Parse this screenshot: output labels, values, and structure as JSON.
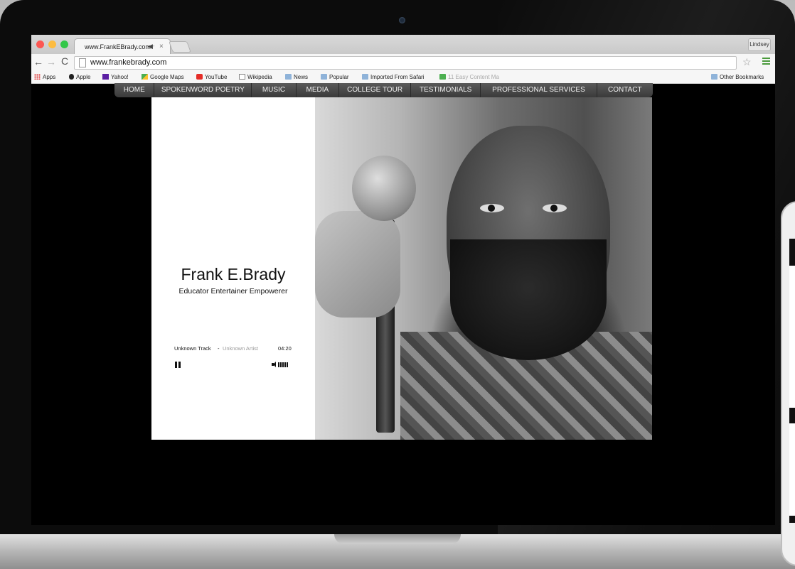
{
  "browser": {
    "tab_title": "www.FrankEBrady.com",
    "tab_audio_icon": "speaker-icon",
    "tab_close": "×",
    "profile_name": "Lindsey",
    "url": "www.frankebrady.com",
    "nav": {
      "back": "←",
      "forward": "→",
      "reload": "C",
      "star": "☆"
    }
  },
  "bookmarks": {
    "items": [
      {
        "label": "Apps",
        "icon": "apps-icon"
      },
      {
        "label": "Apple",
        "icon": "apple-icon"
      },
      {
        "label": "Yahoo!",
        "icon": "yahoo-icon"
      },
      {
        "label": "Google Maps",
        "icon": "maps-icon"
      },
      {
        "label": "YouTube",
        "icon": "youtube-icon"
      },
      {
        "label": "Wikipedia",
        "icon": "wikipedia-icon"
      },
      {
        "label": "News",
        "icon": "folder-icon"
      },
      {
        "label": "Popular",
        "icon": "folder-icon"
      },
      {
        "label": "Imported From Safari",
        "icon": "folder-icon"
      },
      {
        "label": "11 Easy Content Ma",
        "icon": "bookmark-icon"
      }
    ],
    "other": "Other Bookmarks"
  },
  "site": {
    "nav": [
      "HOME",
      "SPOKENWORD POETRY",
      "MUSIC",
      "MEDIA",
      "COLLEGE TOUR",
      "TESTIMONIALS",
      "PROFESSIONAL SERVICES",
      "CONTACT"
    ],
    "name": "Frank E.Brady",
    "tagline": "Educator Entertainer Empowerer",
    "player": {
      "track": "Unknown Track",
      "separator": "-",
      "artist": "Unknown Artist",
      "time": "04:20",
      "state": "playing"
    }
  },
  "colors": {
    "site_background": "#000000",
    "nav_bar": "#4a4a4a",
    "traffic_red": "#fc5753",
    "traffic_yellow": "#fdbc40",
    "traffic_green": "#33c748"
  }
}
